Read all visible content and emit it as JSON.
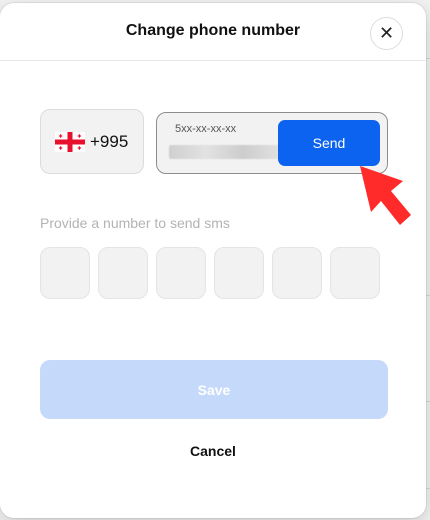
{
  "dialog": {
    "title": "Change phone number",
    "close_icon": "close-icon",
    "close_glyph": "✕"
  },
  "phone": {
    "country_flag": "georgia-flag-icon",
    "country_code": "+995",
    "placeholder": "5xx-xx-xx-xx",
    "send_label": "Send"
  },
  "otp": {
    "hint": "Provide a number to send sms",
    "cells": [
      "",
      "",
      "",
      "",
      "",
      ""
    ]
  },
  "actions": {
    "save_label": "Save",
    "cancel_label": "Cancel"
  },
  "colors": {
    "primary": "#0b63f0",
    "primary_disabled": "#c5d9fb",
    "annotation_arrow": "#ff2a2a"
  }
}
